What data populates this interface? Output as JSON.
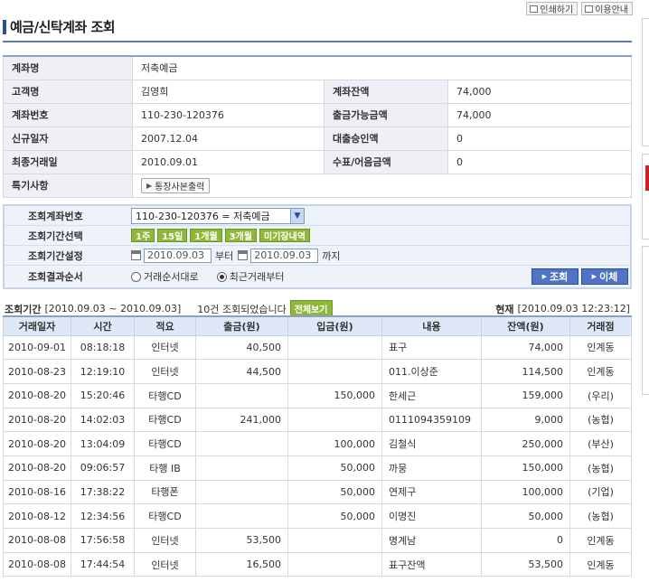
{
  "top_links": [
    {
      "label": "인쇄하기",
      "icon": "print-icon"
    },
    {
      "label": "이용안내",
      "icon": "guide-icon"
    }
  ],
  "page_title": "예금/신탁계좌 조회",
  "account": {
    "name_label": "계좌명",
    "name_value": "저축예금",
    "customer_label": "고객명",
    "customer_value": "김영희",
    "balance_label": "계좌잔액",
    "balance_value": "74,000",
    "number_label": "계좌번호",
    "number_value": "110-230-120376",
    "withdrawable_label": "출금가능금액",
    "withdrawable_value": "74,000",
    "opened_label": "신규일자",
    "opened_value": "2007.12.04",
    "loan_label": "대출승인액",
    "loan_value": "0",
    "last_tx_label": "최종거래일",
    "last_tx_value": "2010.09.01",
    "check_label": "수표/어음금액",
    "check_value": "0",
    "special_label": "특기사항",
    "passbook_button": "통장사본출력"
  },
  "search": {
    "account_label": "조회계좌번호",
    "account_selected": "110-230-120376 = 저축예금",
    "period_select_label": "조회기간선택",
    "period_buttons": [
      "1주",
      "15일",
      "1개월",
      "3개월",
      "미기장내역"
    ],
    "period_set_label": "조회기간설정",
    "date_from": "2010.09.03",
    "from_suffix": "부터",
    "date_to": "2010.09.03",
    "to_suffix": "까지",
    "order_label": "조회결과순서",
    "order_options": [
      "거래순서대로",
      "최근거래부터"
    ],
    "order_selected": 1,
    "search_button": "조회",
    "transfer_button": "이체"
  },
  "summary": {
    "period_label": "조회기간",
    "period_value": "[2010.09.03 ~ 2010.09.03]",
    "count_text": "10건 조회되었습니다",
    "view_all_button": "전체보기",
    "now_label": "현재",
    "now_value": "[2010.09.03 12:23:12]"
  },
  "table": {
    "headers": [
      "거래일자",
      "시간",
      "적요",
      "출금(원)",
      "입금(원)",
      "내용",
      "잔액(원)",
      "거래점"
    ],
    "rows": [
      [
        "2010-09-01",
        "08:18:18",
        "인터넷",
        "40,500",
        "",
        "표구",
        "74,000",
        "인계동"
      ],
      [
        "2010-08-23",
        "12:19:10",
        "인터넷",
        "44,500",
        "",
        "011.이상준",
        "114,500",
        "인계동"
      ],
      [
        "2010-08-20",
        "15:20:46",
        "타행CD",
        "",
        "150,000",
        "한세근",
        "159,000",
        "(우리)"
      ],
      [
        "2010-08-20",
        "14:02:03",
        "타행CD",
        "241,000",
        "",
        "0111094359109",
        "9,000",
        "(농협)"
      ],
      [
        "2010-08-20",
        "13:04:09",
        "타행CD",
        "",
        "100,000",
        "김철식",
        "250,000",
        "(부산)"
      ],
      [
        "2010-08-20",
        "09:06:57",
        "타행 IB",
        "",
        "50,000",
        "까뭉",
        "150,000",
        "(농협)"
      ],
      [
        "2010-08-16",
        "17:38:22",
        "타행폰",
        "",
        "50,000",
        "연제구",
        "100,000",
        "(기업)"
      ],
      [
        "2010-08-12",
        "12:34:56",
        "타행CD",
        "",
        "50,000",
        "이명진",
        "50,000",
        "(농협)"
      ],
      [
        "2010-08-08",
        "17:56:58",
        "인터넷",
        "53,500",
        "",
        "명계남",
        "0",
        "인계동"
      ],
      [
        "2010-08-08",
        "17:44:54",
        "인터넷",
        "16,500",
        "",
        "표구잔액",
        "53,500",
        "인계동"
      ]
    ]
  }
}
